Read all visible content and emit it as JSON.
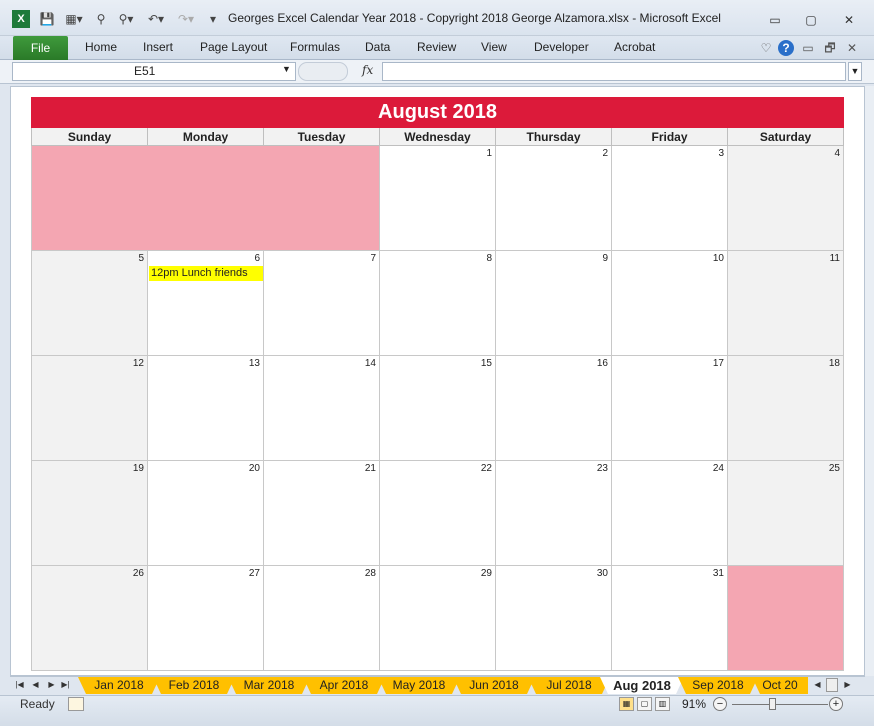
{
  "window": {
    "title": "Georges Excel Calendar Year 2018  -  Copyright 2018 George Alzamora.xlsx  -  Microsoft Excel",
    "controls": {
      "minimize": "▭",
      "restore": "▢",
      "close": "✕"
    },
    "doc_controls": {
      "help": "?",
      "minimize": "▭",
      "restore": "🗗",
      "close": "✕"
    }
  },
  "ribbon": {
    "file_label": "File",
    "tabs": [
      "Home",
      "Insert",
      "Page Layout",
      "Formulas",
      "Data",
      "Review",
      "View",
      "Developer",
      "Acrobat"
    ]
  },
  "formula_bar": {
    "name_box": "E51",
    "fx": "fx",
    "value": ""
  },
  "calendar": {
    "title": "August 2018",
    "weekdays": [
      "Sunday",
      "Monday",
      "Tuesday",
      "Wednesday",
      "Thursday",
      "Friday",
      "Saturday"
    ],
    "weeks": [
      [
        "",
        "",
        "",
        "1",
        "2",
        "3",
        "4"
      ],
      [
        "5",
        "6",
        "7",
        "8",
        "9",
        "10",
        "11"
      ],
      [
        "12",
        "13",
        "14",
        "15",
        "16",
        "17",
        "18"
      ],
      [
        "19",
        "20",
        "21",
        "22",
        "23",
        "24",
        "25"
      ],
      [
        "26",
        "27",
        "28",
        "29",
        "30",
        "31",
        ""
      ]
    ],
    "event": {
      "date": "6",
      "text": "12pm Lunch friends",
      "color": "#ffff00"
    },
    "colors": {
      "header": "#dc1a3a",
      "blank": "#f4a6b2",
      "weekend": "#f2f2f2"
    }
  },
  "sheet_tabs": [
    "Jan 2018",
    "Feb 2018",
    "Mar 2018",
    "Apr 2018",
    "May 2018",
    "Jun 2018",
    "Jul 2018",
    "Aug 2018",
    "Sep 2018",
    "Oct 20"
  ],
  "active_tab": "Aug 2018",
  "status": {
    "ready": "Ready",
    "zoom": "91%",
    "zoom_out": "−",
    "zoom_in": "+"
  }
}
